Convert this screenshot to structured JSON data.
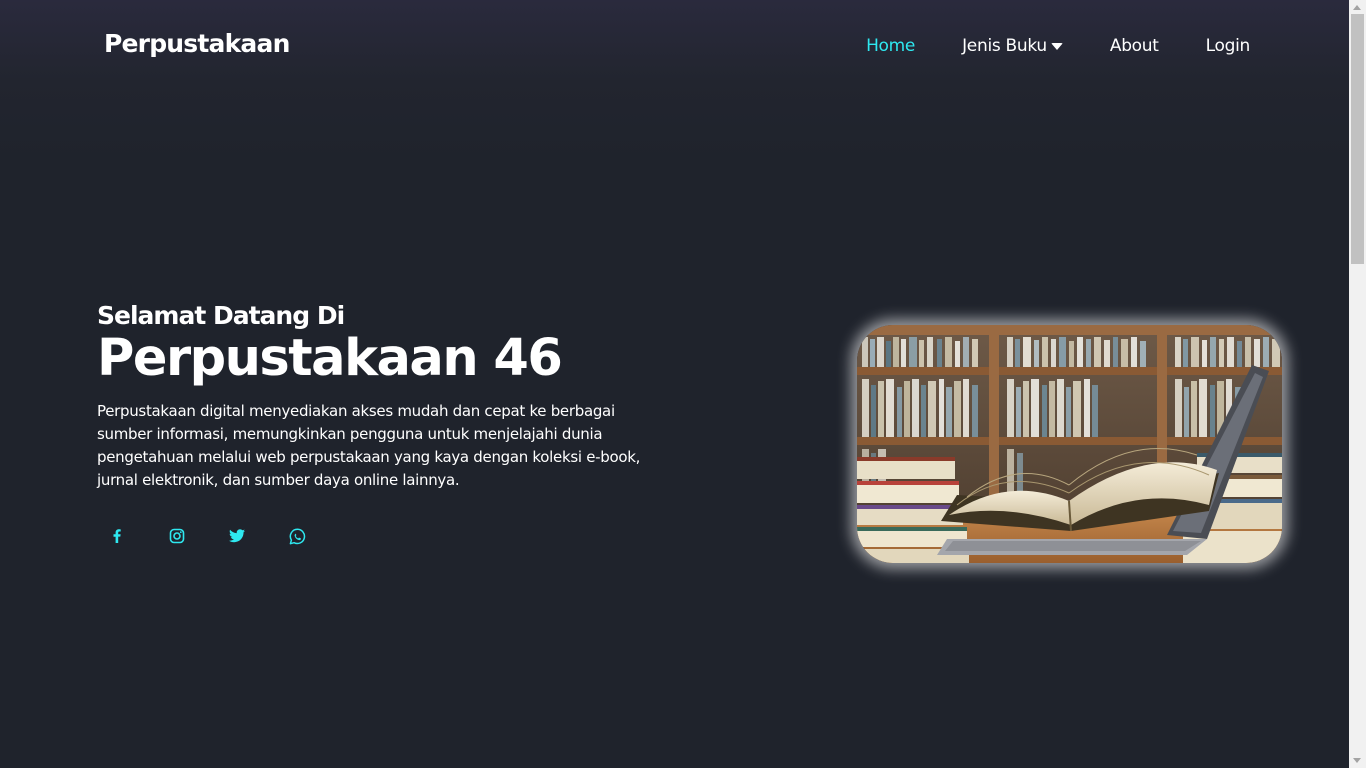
{
  "header": {
    "logo": "Perpustakaan",
    "nav": [
      {
        "label": "Home",
        "active": true
      },
      {
        "label": "Jenis Buku",
        "dropdown": true
      },
      {
        "label": "About"
      },
      {
        "label": "Login"
      }
    ]
  },
  "hero": {
    "welcome": "Selamat Datang Di",
    "title": "Perpustakaan 46",
    "description": "Perpustakaan digital menyediakan akses mudah dan cepat ke berbagai sumber informasi, memungkinkan pengguna untuk menjelajahi dunia pengetahuan melalui web perpustakaan yang kaya dengan koleksi e-book, jurnal elektronik, dan sumber daya online lainnya."
  },
  "socials": [
    {
      "icon": "facebook-icon"
    },
    {
      "icon": "instagram-icon"
    },
    {
      "icon": "twitter-icon"
    },
    {
      "icon": "whatsapp-icon"
    }
  ],
  "colors": {
    "background": "#1f232c",
    "accent": "#2ee8f0",
    "text": "#ffffff"
  }
}
